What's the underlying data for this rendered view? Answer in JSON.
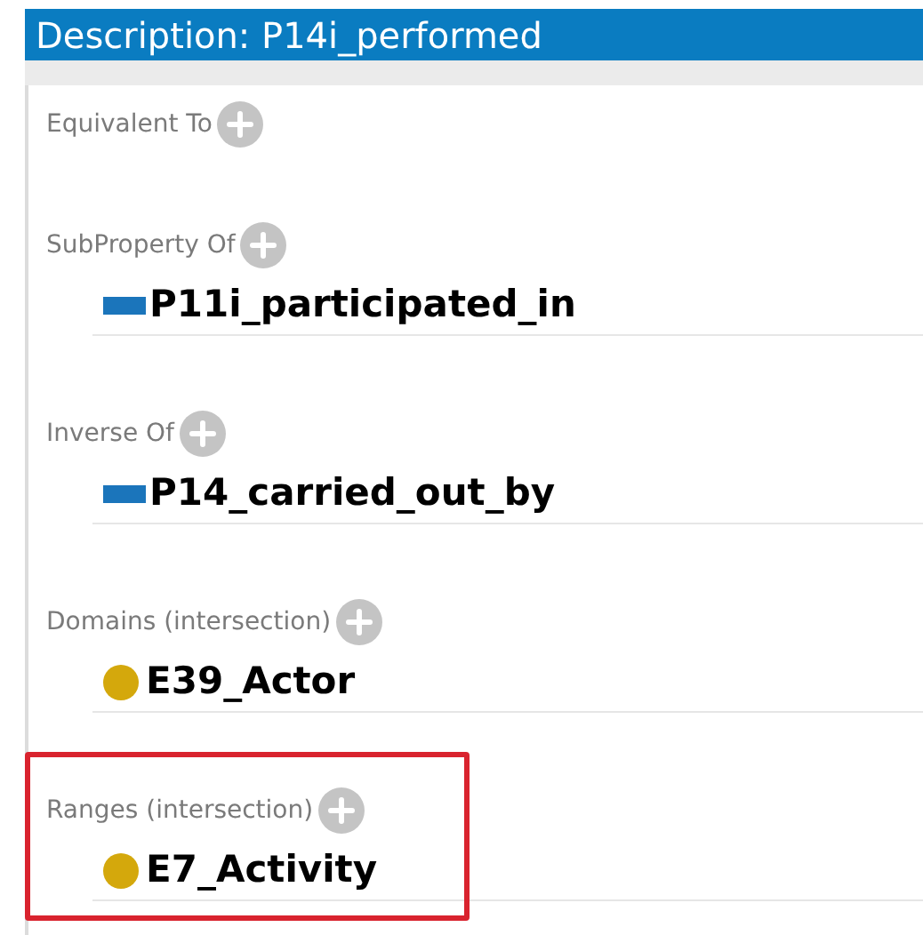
{
  "title": "Description: P14i_performed",
  "sections": [
    {
      "label": "Equivalent To",
      "highlighted": false
    },
    {
      "label": "SubProperty Of",
      "highlighted": false,
      "items": [
        {
          "kind": "property",
          "name": "P11i_participated_in"
        }
      ]
    },
    {
      "label": "Inverse Of",
      "highlighted": false,
      "items": [
        {
          "kind": "property",
          "name": "P14_carried_out_by"
        }
      ]
    },
    {
      "label": "Domains (intersection)",
      "highlighted": false,
      "items": [
        {
          "kind": "class",
          "name": "E39_Actor"
        }
      ]
    },
    {
      "label": "Ranges (intersection)",
      "highlighted": true,
      "items": [
        {
          "kind": "class",
          "name": "E7_Activity"
        }
      ]
    }
  ]
}
